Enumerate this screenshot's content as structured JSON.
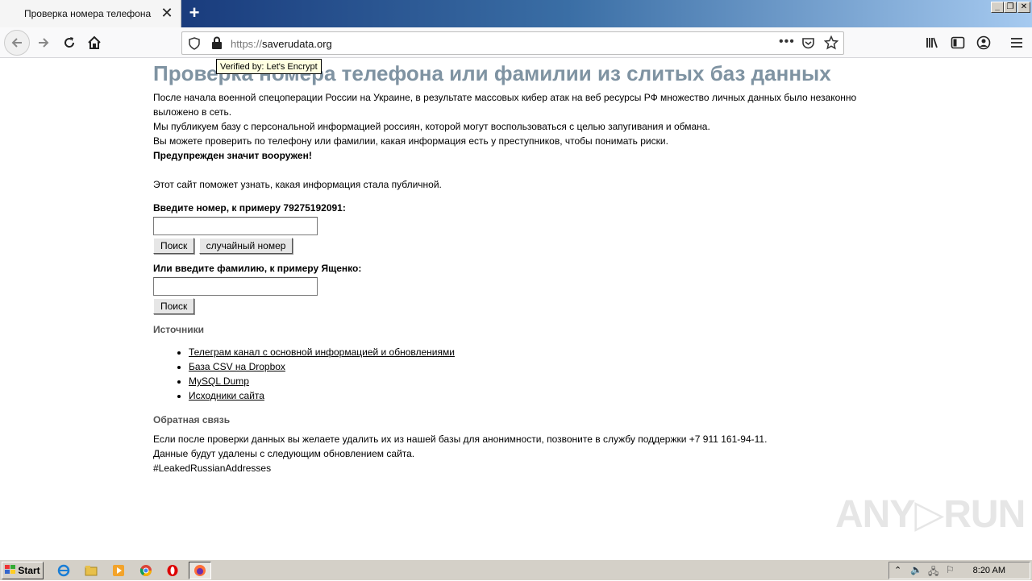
{
  "browser": {
    "tab_title": "Проверка номера телефона",
    "tab_close": "✕",
    "new_tab": "+",
    "url_scheme": "https://",
    "url_host": "saverudata.org",
    "tooltip": "Verified by: Let's Encrypt",
    "window_buttons": [
      "_",
      "❐",
      "✕"
    ]
  },
  "page": {
    "title": "Проверка номера телефона или фамилии из слитых баз данных",
    "intro": [
      "После начала военной спецоперации России на Украине, в результате массовых кибер атак на веб ресурсы РФ множество личных данных было незаконно выложено в сеть.",
      "Мы публикуем базу с персональной информацией россиян, которой могут воспользоваться с целью запугивания и обмана.",
      "Вы можете проверить по телефону или фамилии, какая информация есть у преступников, чтобы понимать риски."
    ],
    "warning": "Предупрежден значит вооружен!",
    "info": "Этот сайт поможет узнать, какая информация стала публичной.",
    "phone_label": "Введите номер, к примеру 79275192091:",
    "phone_value": "",
    "search_button": "Поиск",
    "random_button": "случайный номер",
    "surname_label": "Или введите фамилию, к примеру Ященко:",
    "surname_value": "",
    "search_button2": "Поиск",
    "sources_heading": "Источники",
    "sources": [
      "Телеграм канал с основной информацией и обновлениями",
      "База CSV на Dropbox",
      "MySQL Dump",
      "Исходники сайта"
    ],
    "feedback_heading": "Обратная связь",
    "feedback_lines": [
      "Если после проверки данных вы желаете удалить их из нашей базы для анонимности, позвоните в службу поддержки +7 911 161-94-11.",
      "Данные будут удалены с следующим обновлением сайта.",
      "#LeakedRussianAddresses"
    ]
  },
  "watermark": "ANY▷RUN",
  "taskbar": {
    "start_label": "Start",
    "clock": "8:20 AM"
  }
}
